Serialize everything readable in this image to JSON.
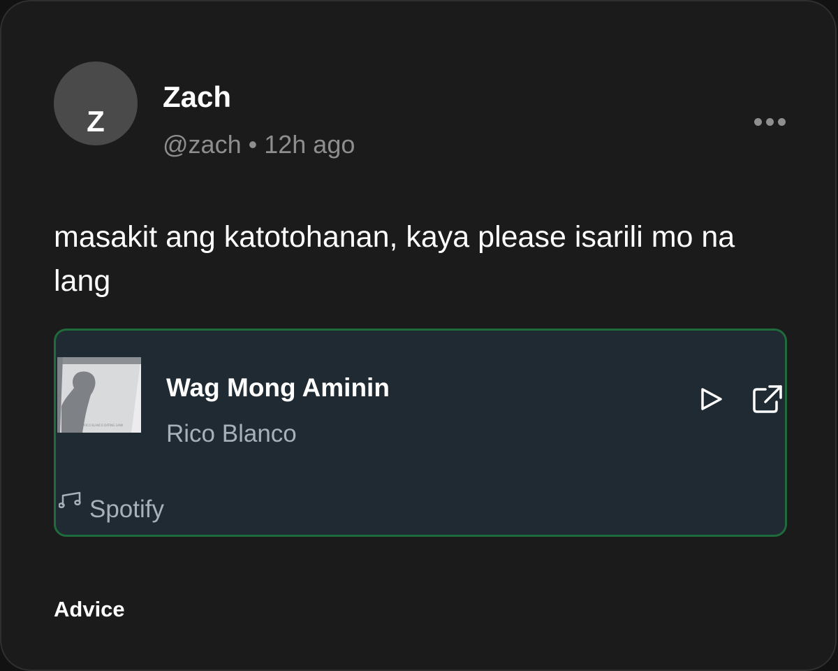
{
  "post": {
    "author": {
      "initial": "Z",
      "name": "Zach",
      "handle": "@zach",
      "separator": "•",
      "time": "12h ago"
    },
    "text": "masakit ang katotohanan, kaya please isarili mo na lang",
    "embed": {
      "title": "Wag Mong Aminin",
      "artist": "Rico Blanco",
      "source": "Spotify",
      "album_art_caption": "RICO BLANCO   DATING GAWI",
      "accent_border_color": "#1f6b3c",
      "background_color": "#1f2a32"
    },
    "tag": "Advice"
  },
  "icons": {
    "more": "ellipsis-icon",
    "play": "play-icon",
    "open": "external-link-icon",
    "source": "music-note-icon"
  }
}
